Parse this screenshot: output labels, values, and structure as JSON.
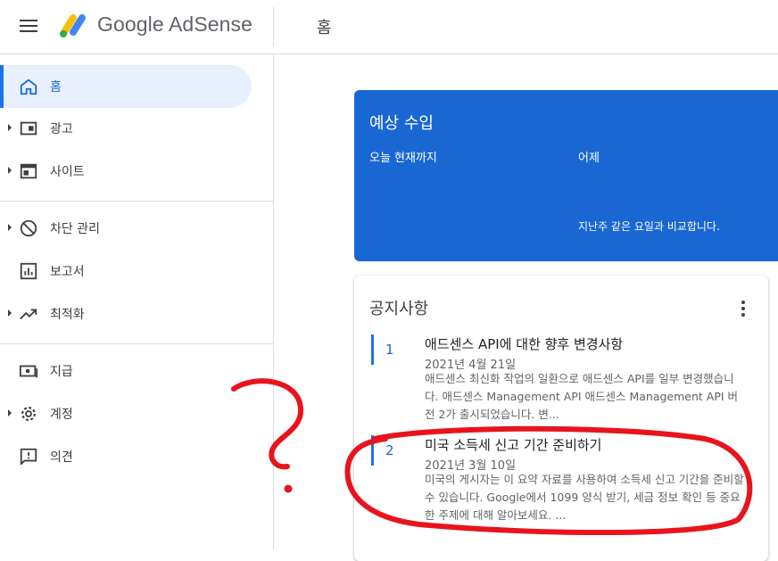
{
  "header": {
    "brand": "Google AdSense",
    "page_title": "홈"
  },
  "sidebar": {
    "items": [
      {
        "label": "홈",
        "icon": "home-icon",
        "active": true
      },
      {
        "label": "광고",
        "icon": "ads-icon"
      },
      {
        "label": "사이트",
        "icon": "sites-icon"
      },
      {
        "label": "차단 관리",
        "icon": "block-icon"
      },
      {
        "label": "보고서",
        "icon": "report-icon"
      },
      {
        "label": "최적화",
        "icon": "trending-icon"
      },
      {
        "label": "지급",
        "icon": "payment-icon"
      },
      {
        "label": "계정",
        "icon": "gear-icon"
      },
      {
        "label": "의견",
        "icon": "feedback-icon"
      }
    ]
  },
  "earnings": {
    "title": "예상 수입",
    "today_label": "오늘 현재까지",
    "yesterday_label": "어제",
    "compare_text": "지난주 같은 요일과 비교합니다."
  },
  "notices": {
    "title": "공지사항",
    "items": [
      {
        "number": "1",
        "title": "애드센스 API에 대한 향후 변경사항",
        "date": "2021년 4월 21일",
        "body": "애드센스 최신화 작업의 일환으로 애드센스 API를 일부 변경했습니다. 애드센스 Management API 애드센스 Management API 버전 2가 출시되었습니다. 변..."
      },
      {
        "number": "2",
        "title": "미국 소득세 신고 기간 준비하기",
        "date": "2021년 3월 10일",
        "body": "미국의 게시자는 이 요약 자료를 사용하여 소득세 신고 기간을 준비할 수 있습니다. Google에서 1099 양식 받기, 세금 정보 확인 등 중요한 주제에 대해 알아보세요. ..."
      }
    ]
  },
  "colors": {
    "accent": "#1a73e8",
    "earnings_card": "#1967d2",
    "annotation": "#e8141c"
  }
}
